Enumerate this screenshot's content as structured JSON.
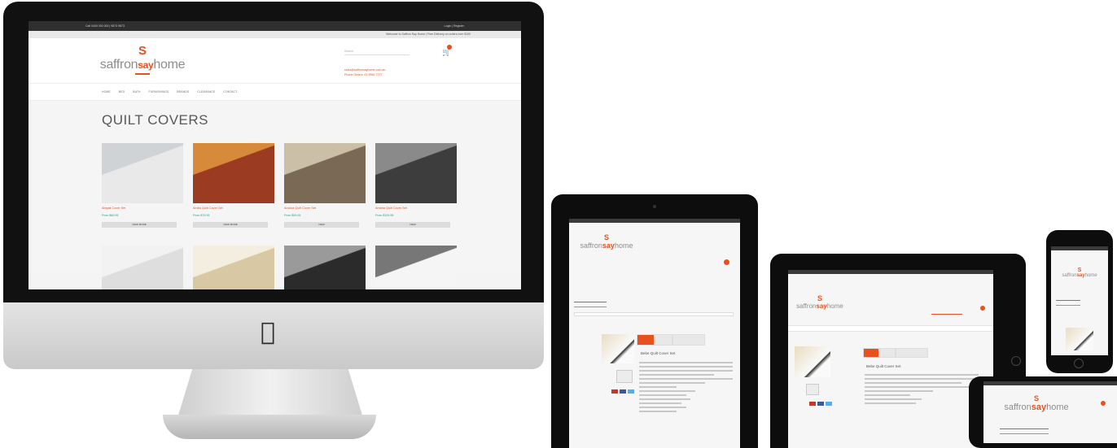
{
  "imac_site": {
    "topbar_left": "Call 0400 000 000 | 9873 9873",
    "topbar_right": "Login | Register",
    "strip_text": "Welcome to Saffron Say Home | Free Delivery on orders over $100",
    "logo": {
      "glyph": "S",
      "brand_pre": "saffron",
      "brand_say": "say",
      "brand_post": "home"
    },
    "search_placeholder": "Search",
    "contact_email": "sales@saffronsayhome.com.au",
    "contact_phone": "Phone Orders: 03 9555 7777",
    "nav": [
      "HOME",
      "BED",
      "BATH",
      "FURNISHINGS",
      "BRANDS",
      "CLEARANCE",
      "CONTACT"
    ],
    "page_title": "QUILT COVERS",
    "products": [
      {
        "name": "Abigail Cover Set",
        "price": "From $69.95",
        "button": "VIEW MORE",
        "colors": [
          "#e9e9e9",
          "#cfd3d6"
        ]
      },
      {
        "name": "Amira Quilt Cover Set",
        "price": "From $79.95",
        "button": "VIEW MORE",
        "colors": [
          "#9a3b22",
          "#d88a3b"
        ]
      },
      {
        "name": "Andora Quilt Cover Set",
        "price": "From $99.95",
        "button": "VIEW",
        "colors": [
          "#7a6a55",
          "#cbbfa8"
        ]
      },
      {
        "name": "Ambria Quilt Cover Set",
        "price": "From $109.95",
        "button": "VIEW",
        "colors": [
          "#3d3d3d",
          "#8a8a8a"
        ]
      },
      {
        "name": "",
        "price": "",
        "button": "",
        "colors": [
          "#dedede",
          "#f2f2f2"
        ]
      },
      {
        "name": "",
        "price": "",
        "button": "",
        "colors": [
          "#d8c9a4",
          "#f3eee0"
        ]
      },
      {
        "name": "",
        "price": "",
        "button": "",
        "colors": [
          "#2b2b2b",
          "#9a9a9a"
        ]
      },
      {
        "name": "",
        "price": "",
        "button": "",
        "colors": [
          "#f5f5f5",
          "#777777"
        ]
      }
    ]
  },
  "mobile_site": {
    "logo": {
      "glyph": "S",
      "brand_pre": "saffron",
      "brand_say": "say",
      "brand_post": "home"
    },
    "product_title": "Bebe Quilt Cover Set"
  },
  "colors": {
    "accent": "#e8501e",
    "price": "#2a9d8f",
    "device": "#0d0d0d"
  },
  "icons": {
    "apple": "apple-logo-icon",
    "cart": "cart-icon"
  }
}
